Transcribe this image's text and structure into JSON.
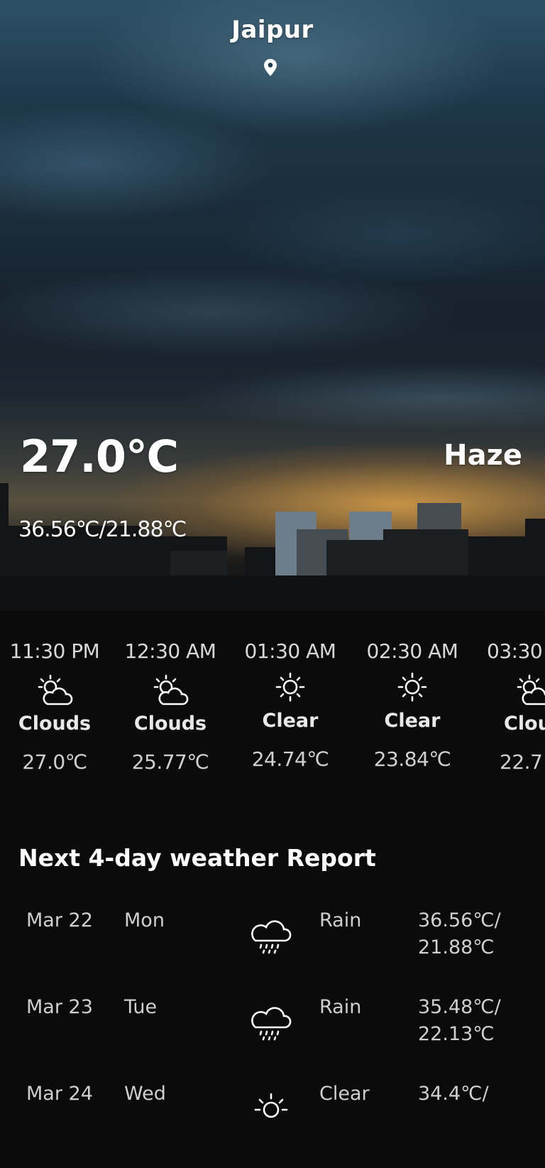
{
  "location": {
    "city": "Jaipur",
    "icon": "location-pin-icon"
  },
  "current": {
    "temperature": "27.0℃",
    "condition": "Haze",
    "range": "36.56℃/21.88℃"
  },
  "hourly": [
    {
      "time": "11:30 PM",
      "icon": "partly-cloudy-icon",
      "condition": "Clouds",
      "temp": "27.0℃"
    },
    {
      "time": "12:30 AM",
      "icon": "partly-cloudy-icon",
      "condition": "Clouds",
      "temp": "25.77℃"
    },
    {
      "time": "01:30 AM",
      "icon": "sun-icon",
      "condition": "Clear",
      "temp": "24.74℃"
    },
    {
      "time": "02:30 AM",
      "icon": "sun-icon",
      "condition": "Clear",
      "temp": "23.84℃"
    },
    {
      "time": "03:30",
      "icon": "partly-cloudy-icon",
      "condition": "Clou",
      "temp": "22.7"
    }
  ],
  "daily_title": "Next 4-day weather Report",
  "daily": [
    {
      "date": "Mar 22",
      "day": "Mon",
      "icon": "rain-cloud-icon",
      "condition": "Rain",
      "high": "36.56℃/",
      "low": "21.88℃"
    },
    {
      "date": "Mar 23",
      "day": "Tue",
      "icon": "rain-cloud-icon",
      "condition": "Rain",
      "high": "35.48℃/",
      "low": "22.13℃"
    },
    {
      "date": "Mar 24",
      "day": "Wed",
      "icon": "sun-icon",
      "condition": "Clear",
      "high": "34.4℃/",
      "low": ""
    }
  ]
}
